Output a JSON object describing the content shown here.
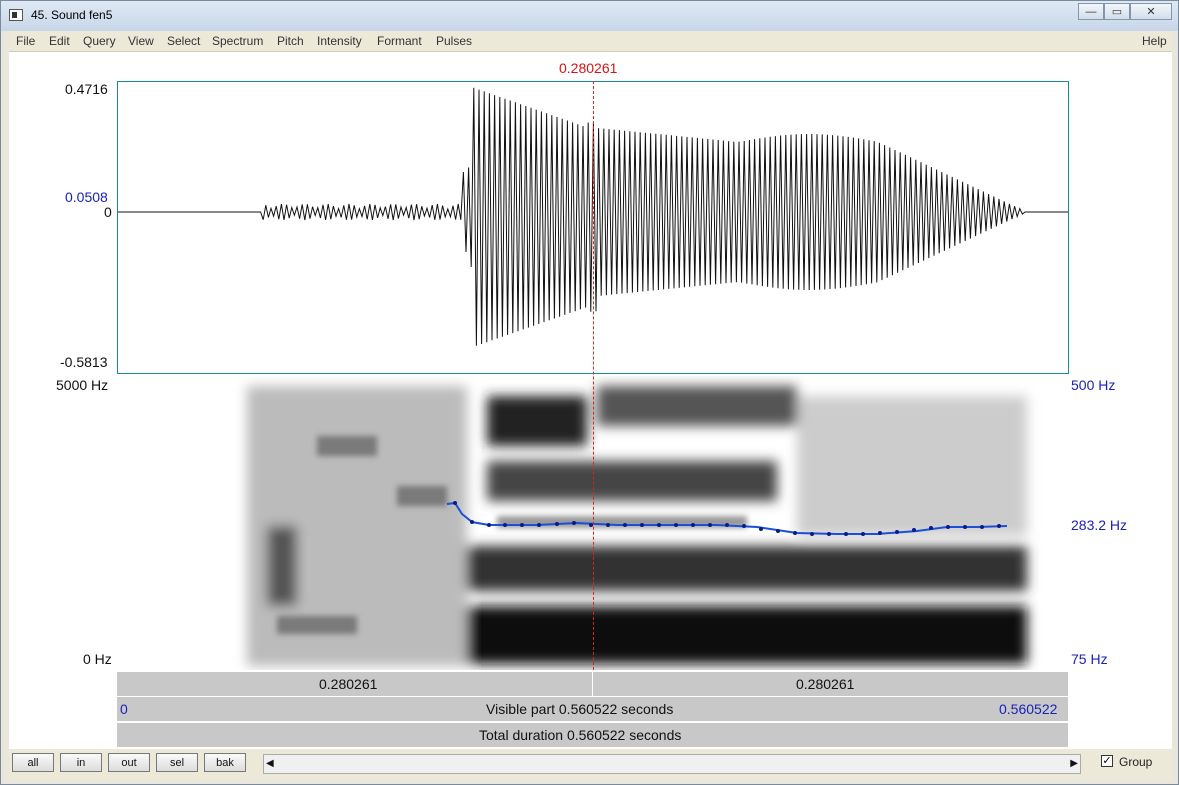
{
  "window": {
    "title": "45. Sound fen5",
    "minimize": "—",
    "maximize": "▭",
    "close": "✕"
  },
  "menu": [
    "File",
    "Edit",
    "Query",
    "View",
    "Select",
    "Spectrum",
    "Pitch",
    "Intensity",
    "Formant",
    "Pulses"
  ],
  "help": "Help",
  "cursor_time": "0.280261",
  "waveform": {
    "y_max": "0.4716",
    "y_cursor_value": "0.0508",
    "y_zero": "0",
    "y_min": "-0.5813"
  },
  "spectrogram": {
    "freq_top": "5000 Hz",
    "freq_bottom": "0 Hz",
    "pitch_top": "500 Hz",
    "pitch_value": "283.2 Hz",
    "pitch_bottom": "75 Hz"
  },
  "bars": {
    "left_segment": "0.280261",
    "right_segment": "0.280261",
    "visible_start": "0",
    "visible_label": "Visible part 0.560522 seconds",
    "visible_end": "0.560522",
    "total_label": "Total duration 0.560522 seconds"
  },
  "buttons": {
    "all": "all",
    "in": "in",
    "out": "out",
    "sel": "sel",
    "bak": "bak"
  },
  "scroll": {
    "left_arrow": "◀",
    "right_arrow": "▶"
  },
  "group": {
    "checked": "✓",
    "label": "Group"
  }
}
